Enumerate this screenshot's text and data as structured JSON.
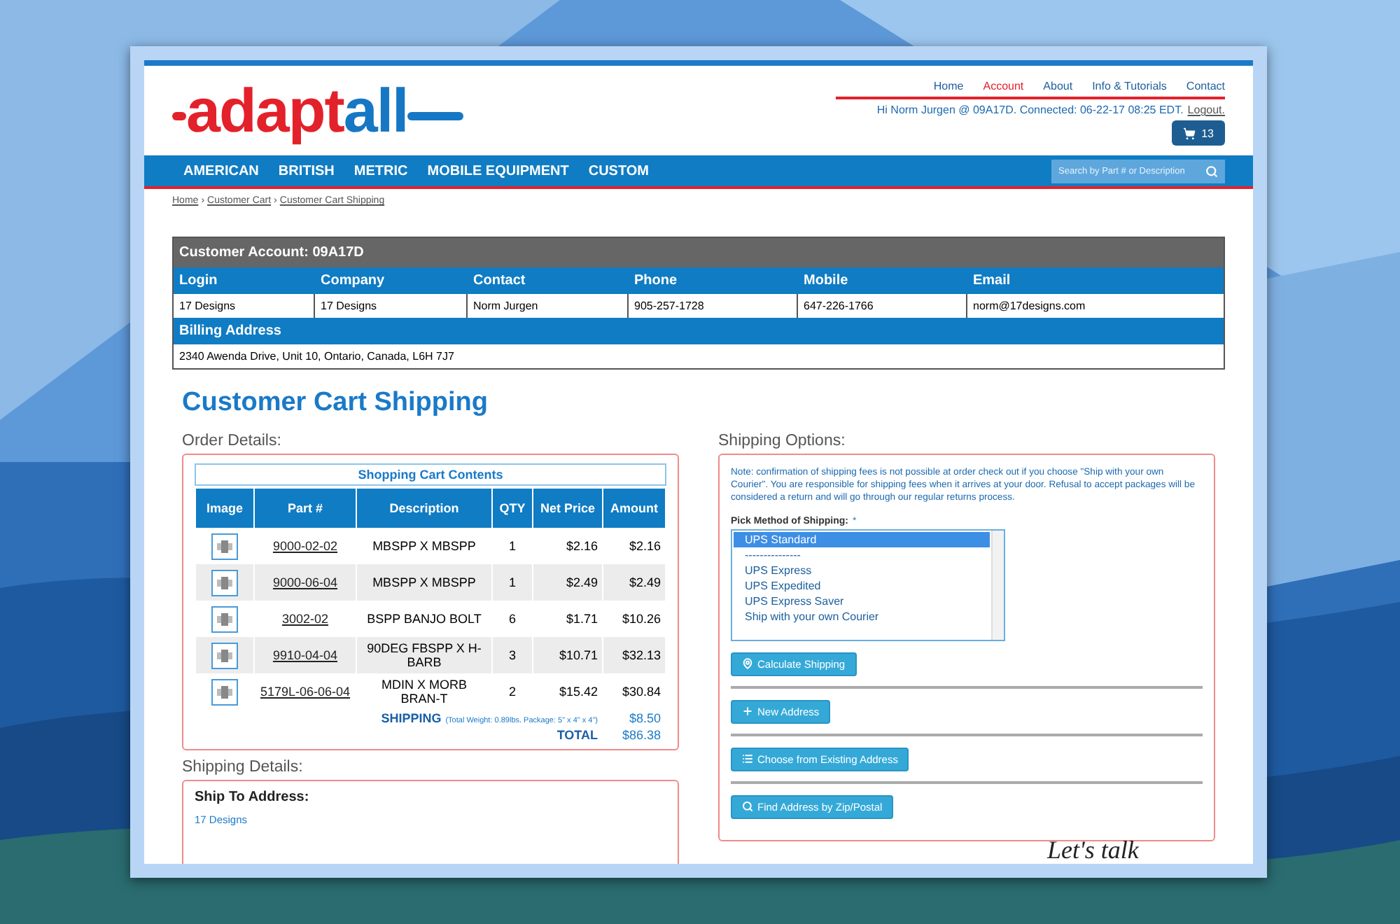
{
  "logo": {
    "part_1": "adapt",
    "part_2": "all"
  },
  "top_links": [
    {
      "label": "Home",
      "selected": false
    },
    {
      "label": "Account",
      "selected": true
    },
    {
      "label": "About",
      "selected": false
    },
    {
      "label": "Info & Tutorials",
      "selected": false
    },
    {
      "label": "Contact",
      "selected": false
    }
  ],
  "greeting": "Hi Norm Jurgen @ 09A17D. Connected: 06-22-17 08:25 EDT.",
  "logout": "Logout.",
  "cart_count": "13",
  "nav": [
    "AMERICAN",
    "BRITISH",
    "METRIC",
    "MOBILE EQUIPMENT",
    "CUSTOM"
  ],
  "search": {
    "placeholder": "Search by Part # or Description"
  },
  "breadcrumb": [
    "Home",
    "›",
    "Customer Cart",
    "›",
    "Customer Cart Shipping"
  ],
  "account": {
    "title": "Customer Account: 09A17D",
    "columns": [
      "Login",
      "Company",
      "Contact",
      "Phone",
      "Mobile",
      "Email"
    ],
    "values": [
      "17 Designs",
      "17 Designs",
      "Norm Jurgen",
      "905-257-1728",
      "647-226-1766",
      "norm@17designs.com"
    ],
    "billing_label": "Billing Address",
    "billing_value": "2340 Awenda Drive, Unit 10, Ontario, Canada, L6H 7J7"
  },
  "page_title": "Customer Cart Shipping",
  "order": {
    "label": "Order Details:",
    "caption": "Shopping Cart Contents",
    "columns": [
      "Image",
      "Part #",
      "Description",
      "QTY",
      "Net Price",
      "Amount"
    ],
    "rows": [
      {
        "part": "9000-02-02",
        "description": "MBSPP X MBSPP",
        "qty": "1",
        "price": "$2.16",
        "amount": "$2.16"
      },
      {
        "part": "9000-06-04",
        "description": "MBSPP X MBSPP",
        "qty": "1",
        "price": "$2.49",
        "amount": "$2.49"
      },
      {
        "part": "3002-02",
        "description": "BSPP BANJO BOLT",
        "qty": "6",
        "price": "$1.71",
        "amount": "$10.26"
      },
      {
        "part": "9910-04-04",
        "description": "90DEG FBSPP X H-BARB",
        "qty": "3",
        "price": "$10.71",
        "amount": "$32.13"
      },
      {
        "part": "5179L-06-06-04",
        "description": "MDIN X MORB BRAN-T",
        "qty": "2",
        "price": "$15.42",
        "amount": "$30.84"
      }
    ],
    "shipping_label": "SHIPPING",
    "shipping_note": "(Total Weight: 0.89lbs. Package: 5\" x 4\" x 4\")",
    "shipping_amount": "$8.50",
    "total_label": "TOTAL",
    "total": "$86.38"
  },
  "shipping_details": {
    "label": "Shipping Details:",
    "heading": "Ship To Address:",
    "name": "17 Designs"
  },
  "shipping_options": {
    "label": "Shipping Options:",
    "note": "Note: confirmation of shipping fees is not possible at order check out if you choose \"Ship with your own Courier\".  You are responsible for shipping fees when it arrives at your door.  Refusal to accept packages will be considered a return and will go through our regular returns process.",
    "pick_label": "Pick Method of Shipping:",
    "required": "*",
    "methods": [
      {
        "label": "UPS Standard",
        "selected": true
      },
      {
        "label": "---------------",
        "selected": false
      },
      {
        "label": "UPS Express",
        "selected": false
      },
      {
        "label": "UPS Expedited",
        "selected": false
      },
      {
        "label": "UPS Express Saver",
        "selected": false
      },
      {
        "label": "Ship with your own Courier",
        "selected": false
      }
    ],
    "buttons": [
      {
        "label": "Calculate Shipping",
        "kind": "pin"
      },
      {
        "label": "New Address",
        "kind": "plus"
      },
      {
        "label": "Choose from Existing Address",
        "kind": "list"
      },
      {
        "label": "Find Address by Zip/Postal",
        "kind": "search"
      }
    ]
  },
  "lets_talk": "Let's talk"
}
